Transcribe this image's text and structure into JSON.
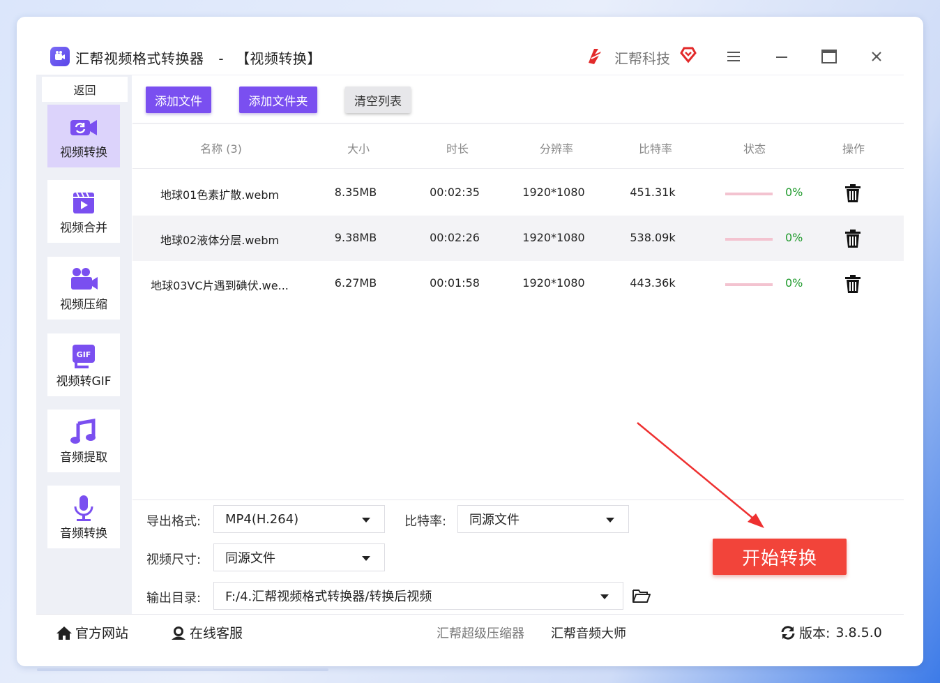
{
  "app": {
    "title": "汇帮视频格式转换器",
    "separator": "-",
    "section": "【视频转换】",
    "brand": "汇帮科技"
  },
  "sidebar": {
    "back_label": "返回",
    "items": [
      {
        "label": "视频转换",
        "icon": "video-convert-icon",
        "active": true
      },
      {
        "label": "视频合并",
        "icon": "video-merge-icon",
        "active": false
      },
      {
        "label": "视频压缩",
        "icon": "video-compress-icon",
        "active": false
      },
      {
        "label": "视频转GIF",
        "icon": "gif-icon",
        "active": false
      },
      {
        "label": "音频提取",
        "icon": "music-note-icon",
        "active": false
      },
      {
        "label": "音频转换",
        "icon": "microphone-icon",
        "active": false
      }
    ]
  },
  "toolbar": {
    "add_file": "添加文件",
    "add_folder": "添加文件夹",
    "clear_list": "清空列表"
  },
  "table": {
    "headers": [
      "名称 (3)",
      "大小",
      "时长",
      "分辨率",
      "比特率",
      "状态",
      "操作"
    ],
    "rows": [
      {
        "name": "地球01色素扩散.webm",
        "size": "8.35MB",
        "duration": "00:02:35",
        "resolution": "1920*1080",
        "bitrate": "451.31k",
        "progress": "0%"
      },
      {
        "name": "地球02液体分层.webm",
        "size": "9.38MB",
        "duration": "00:02:26",
        "resolution": "1920*1080",
        "bitrate": "538.09k",
        "progress": "0%"
      },
      {
        "name": "地球03VC片遇到碘伏.we...",
        "size": "6.27MB",
        "duration": "00:01:58",
        "resolution": "1920*1080",
        "bitrate": "443.36k",
        "progress": "0%"
      }
    ]
  },
  "settings": {
    "format_label": "导出格式:",
    "format_value": "MP4(H.264)",
    "bitrate_label": "比特率:",
    "bitrate_value": "同源文件",
    "size_label": "视频尺寸:",
    "size_value": "同源文件",
    "output_label": "输出目录:",
    "output_value": "F:/4.汇帮视频格式转换器/转换后视频",
    "start_label": "开始转换"
  },
  "footer": {
    "website": "官方网站",
    "service": "在线客服",
    "link1": "汇帮超级压缩器",
    "link2": "汇帮音频大师",
    "version_label": "版本:",
    "version": "3.8.5.0"
  },
  "colors": {
    "accent": "#7a4ff0",
    "start": "#f2443a",
    "progress_text": "#1f9a2c",
    "progress_track": "#f3c3d0"
  }
}
